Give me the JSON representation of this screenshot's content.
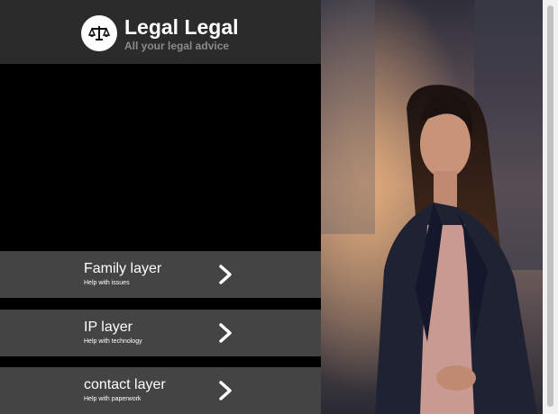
{
  "header": {
    "title": "Legal Legal",
    "subtitle": "All your legal advice",
    "logo_icon": "scales-icon"
  },
  "menu": [
    {
      "title": "Family layer",
      "subtitle": "Help with issues",
      "icon": "chevron-right-icon"
    },
    {
      "title": "IP layer",
      "subtitle": "Help with technology",
      "icon": "chevron-right-icon"
    },
    {
      "title": "contact layer",
      "subtitle": "Help with paperwork",
      "icon": "chevron-right-icon"
    }
  ],
  "colors": {
    "header_bg": "#2b2b2b",
    "menu_item_bg": "#444444",
    "text": "#ffffff",
    "subtitle_text": "#8a8a8a"
  }
}
